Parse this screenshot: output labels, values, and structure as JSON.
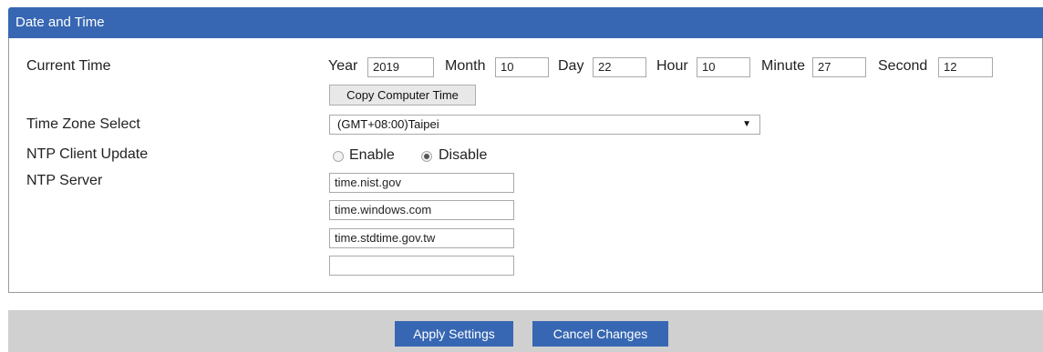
{
  "header": {
    "title": "Date and Time"
  },
  "current_time": {
    "label": "Current Time",
    "year_label": "Year",
    "year_value": "2019",
    "month_label": "Month",
    "month_value": "10",
    "day_label": "Day",
    "day_value": "22",
    "hour_label": "Hour",
    "hour_value": "10",
    "minute_label": "Minute",
    "minute_value": "27",
    "second_label": "Second",
    "second_value": "12",
    "copy_button": "Copy Computer Time"
  },
  "timezone": {
    "label": "Time Zone Select",
    "selected": "(GMT+08:00)Taipei",
    "arrow": "▼"
  },
  "ntp_client": {
    "label": "NTP Client Update",
    "enable_label": "Enable",
    "disable_label": "Disable",
    "selected": "Disable"
  },
  "ntp_server": {
    "label": "NTP Server",
    "servers": [
      "time.nist.gov",
      "time.windows.com",
      "time.stdtime.gov.tw",
      ""
    ]
  },
  "footer": {
    "apply_label": "Apply Settings",
    "cancel_label": "Cancel Changes"
  },
  "colors": {
    "header": "#3767b2",
    "footer_bg": "#d0d0d0"
  }
}
